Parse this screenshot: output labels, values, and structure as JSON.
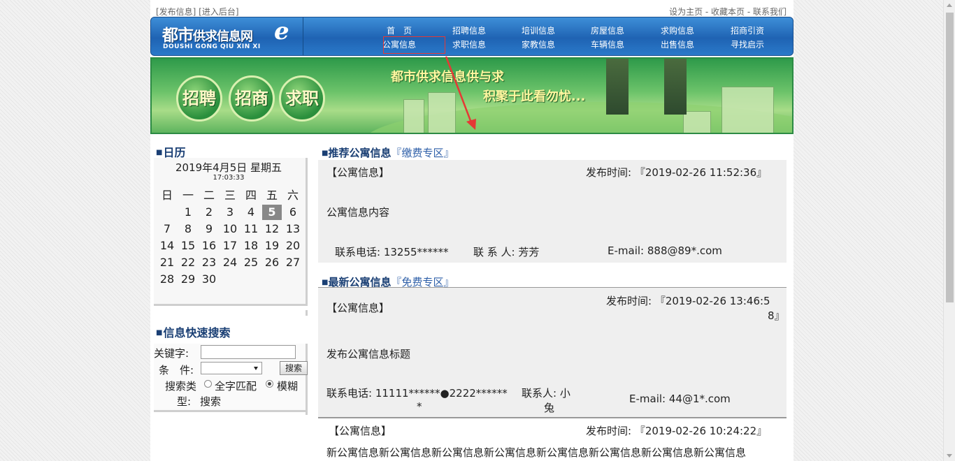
{
  "topbar": {
    "left": "[发布信息] [进入后台]",
    "right": "设为主页 - 收藏本页 - 联系我们"
  },
  "logo": {
    "cn_big": "都市",
    "cn_small": "供求信息网",
    "e": "e",
    "en": "DOUSHI  GONG QIU XIN XI"
  },
  "nav": {
    "row1": [
      "首　页",
      "招聘信息",
      "培训信息",
      "房屋信息",
      "求购信息",
      "招商引资"
    ],
    "row2": [
      "公寓信息",
      "求职信息",
      "家教信息",
      "车辆信息",
      "出售信息",
      "寻找启示"
    ]
  },
  "banner": {
    "buttons": [
      "招聘",
      "招商",
      "求职"
    ],
    "slogan1": "都市供求信息供与求",
    "slogan2": "积聚于此看勿忧..."
  },
  "calendar": {
    "title": "日历",
    "date": "2019年4月5日 星期五",
    "time": "17:03:33",
    "weekdays": [
      "日",
      "一",
      "二",
      "三",
      "四",
      "五",
      "六"
    ],
    "weeks": [
      [
        "",
        "1",
        "2",
        "3",
        "4",
        "5",
        "6"
      ],
      [
        "7",
        "8",
        "9",
        "10",
        "11",
        "12",
        "13"
      ],
      [
        "14",
        "15",
        "16",
        "17",
        "18",
        "19",
        "20"
      ],
      [
        "21",
        "22",
        "23",
        "24",
        "25",
        "26",
        "27"
      ],
      [
        "28",
        "29",
        "30",
        "",
        "",
        "",
        ""
      ]
    ],
    "today": "5"
  },
  "search": {
    "title": "信息快速搜索",
    "keyword_label": "关键字:",
    "keyword_value": "",
    "condition_label": "条　件:",
    "condition_value": "",
    "button": "搜索",
    "type_label_1": "搜索类",
    "type_label_2": "型:",
    "option_exact": "全字匹配",
    "option_fuzzy_1": "模糊",
    "option_fuzzy_2": "搜索",
    "selected": "fuzzy"
  },
  "recommended": {
    "title": "推荐公寓信息",
    "zone": "『缴费专区』",
    "item": {
      "category": "【公寓信息】",
      "time": "发布时间: 『2019-02-26 11:52:36』",
      "content": "公寓信息内容",
      "phone": "联系电话: 13255******",
      "contact": "联 系 人: 芳芳",
      "email": "E-mail: 888@89*.com"
    }
  },
  "latest": {
    "title": "最新公寓信息",
    "zone": "『免费专区』",
    "items": [
      {
        "category": "【公寓信息】",
        "time_1": "发布时间: 『2019-02-26 13:46:5",
        "time_2": "8』",
        "content": "发布公寓信息标题",
        "phone_1": "联系电话: 11111******●2222******",
        "phone_2": "*",
        "contact_1": "联系人: 小",
        "contact_2": "兔",
        "email": "E-mail: 44@1*.com"
      },
      {
        "category": "【公寓信息】",
        "time": "发布时间: 『2019-02-26 10:24:22』",
        "content": "新公寓信息新公寓信息新公寓信息新公寓信息新公寓信息新公寓信息新公寓信息新公寓信息"
      }
    ]
  }
}
